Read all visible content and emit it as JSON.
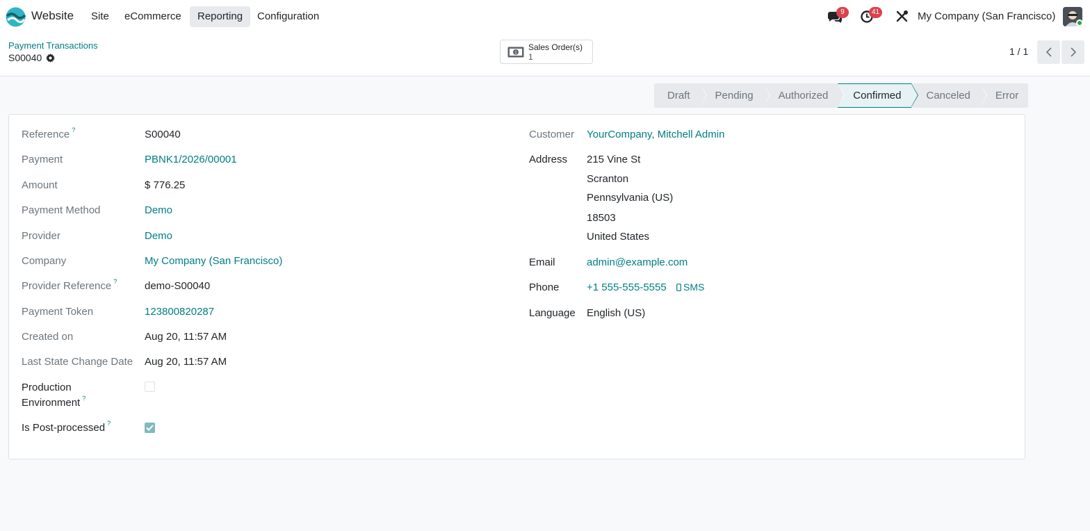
{
  "navbar": {
    "app_name": "Website",
    "menu": [
      "Site",
      "eCommerce",
      "Reporting",
      "Configuration"
    ],
    "active_menu": "Reporting",
    "messages_count": "9",
    "activities_count": "41",
    "company": "My Company (San Francisco)"
  },
  "control": {
    "breadcrumb": "Payment Transactions",
    "record_name": "S00040",
    "smart_button": {
      "label": "Sales Order(s)",
      "value": "1"
    },
    "pager": "1 / 1"
  },
  "statusbar": {
    "stages": [
      "Draft",
      "Pending",
      "Authorized",
      "Confirmed",
      "Canceled",
      "Error"
    ],
    "current": "Confirmed"
  },
  "form": {
    "left": [
      {
        "label": "Reference",
        "help": "?",
        "value": "S00040",
        "is_link": false
      },
      {
        "label": "Payment",
        "help": "",
        "value": "PBNK1/2026/00001",
        "is_link": true
      },
      {
        "label": "Amount",
        "help": "",
        "value": "$ 776.25",
        "is_link": false
      },
      {
        "label": "Payment Method",
        "help": "",
        "value": "Demo",
        "is_link": true
      },
      {
        "label": "Provider",
        "help": "",
        "value": "Demo",
        "is_link": true
      },
      {
        "label": "Company",
        "help": "",
        "value": "My Company (San Francisco)",
        "is_link": true
      },
      {
        "label": "Provider Reference",
        "help": "?",
        "value": "demo-S00040",
        "is_link": false
      },
      {
        "label": "Payment Token",
        "help": "",
        "value": "123800820287",
        "is_link": true
      },
      {
        "label": "Created on",
        "help": "",
        "value": "Aug 20, 11:57 AM",
        "is_link": false
      },
      {
        "label": "Last State Change Date",
        "help": "",
        "value": "Aug 20, 11:57 AM",
        "is_link": false
      }
    ],
    "production_env": {
      "label_line1": "Production",
      "label_line2": "Environment",
      "help": "?",
      "checked": false
    },
    "post_processed": {
      "label": "Is Post-processed",
      "help": "?",
      "checked": true
    },
    "customer": {
      "label": "Customer",
      "value": "YourCompany, Mitchell Admin"
    },
    "address": {
      "label": "Address",
      "lines": [
        "215 Vine St",
        "Scranton",
        "Pennsylvania (US)",
        "18503",
        "United States"
      ]
    },
    "email": {
      "label": "Email",
      "value": "admin@example.com"
    },
    "phone": {
      "label": "Phone",
      "value": "+1 555-555-5555",
      "sms": "SMS"
    },
    "language": {
      "label": "Language",
      "value": "English (US)"
    }
  }
}
